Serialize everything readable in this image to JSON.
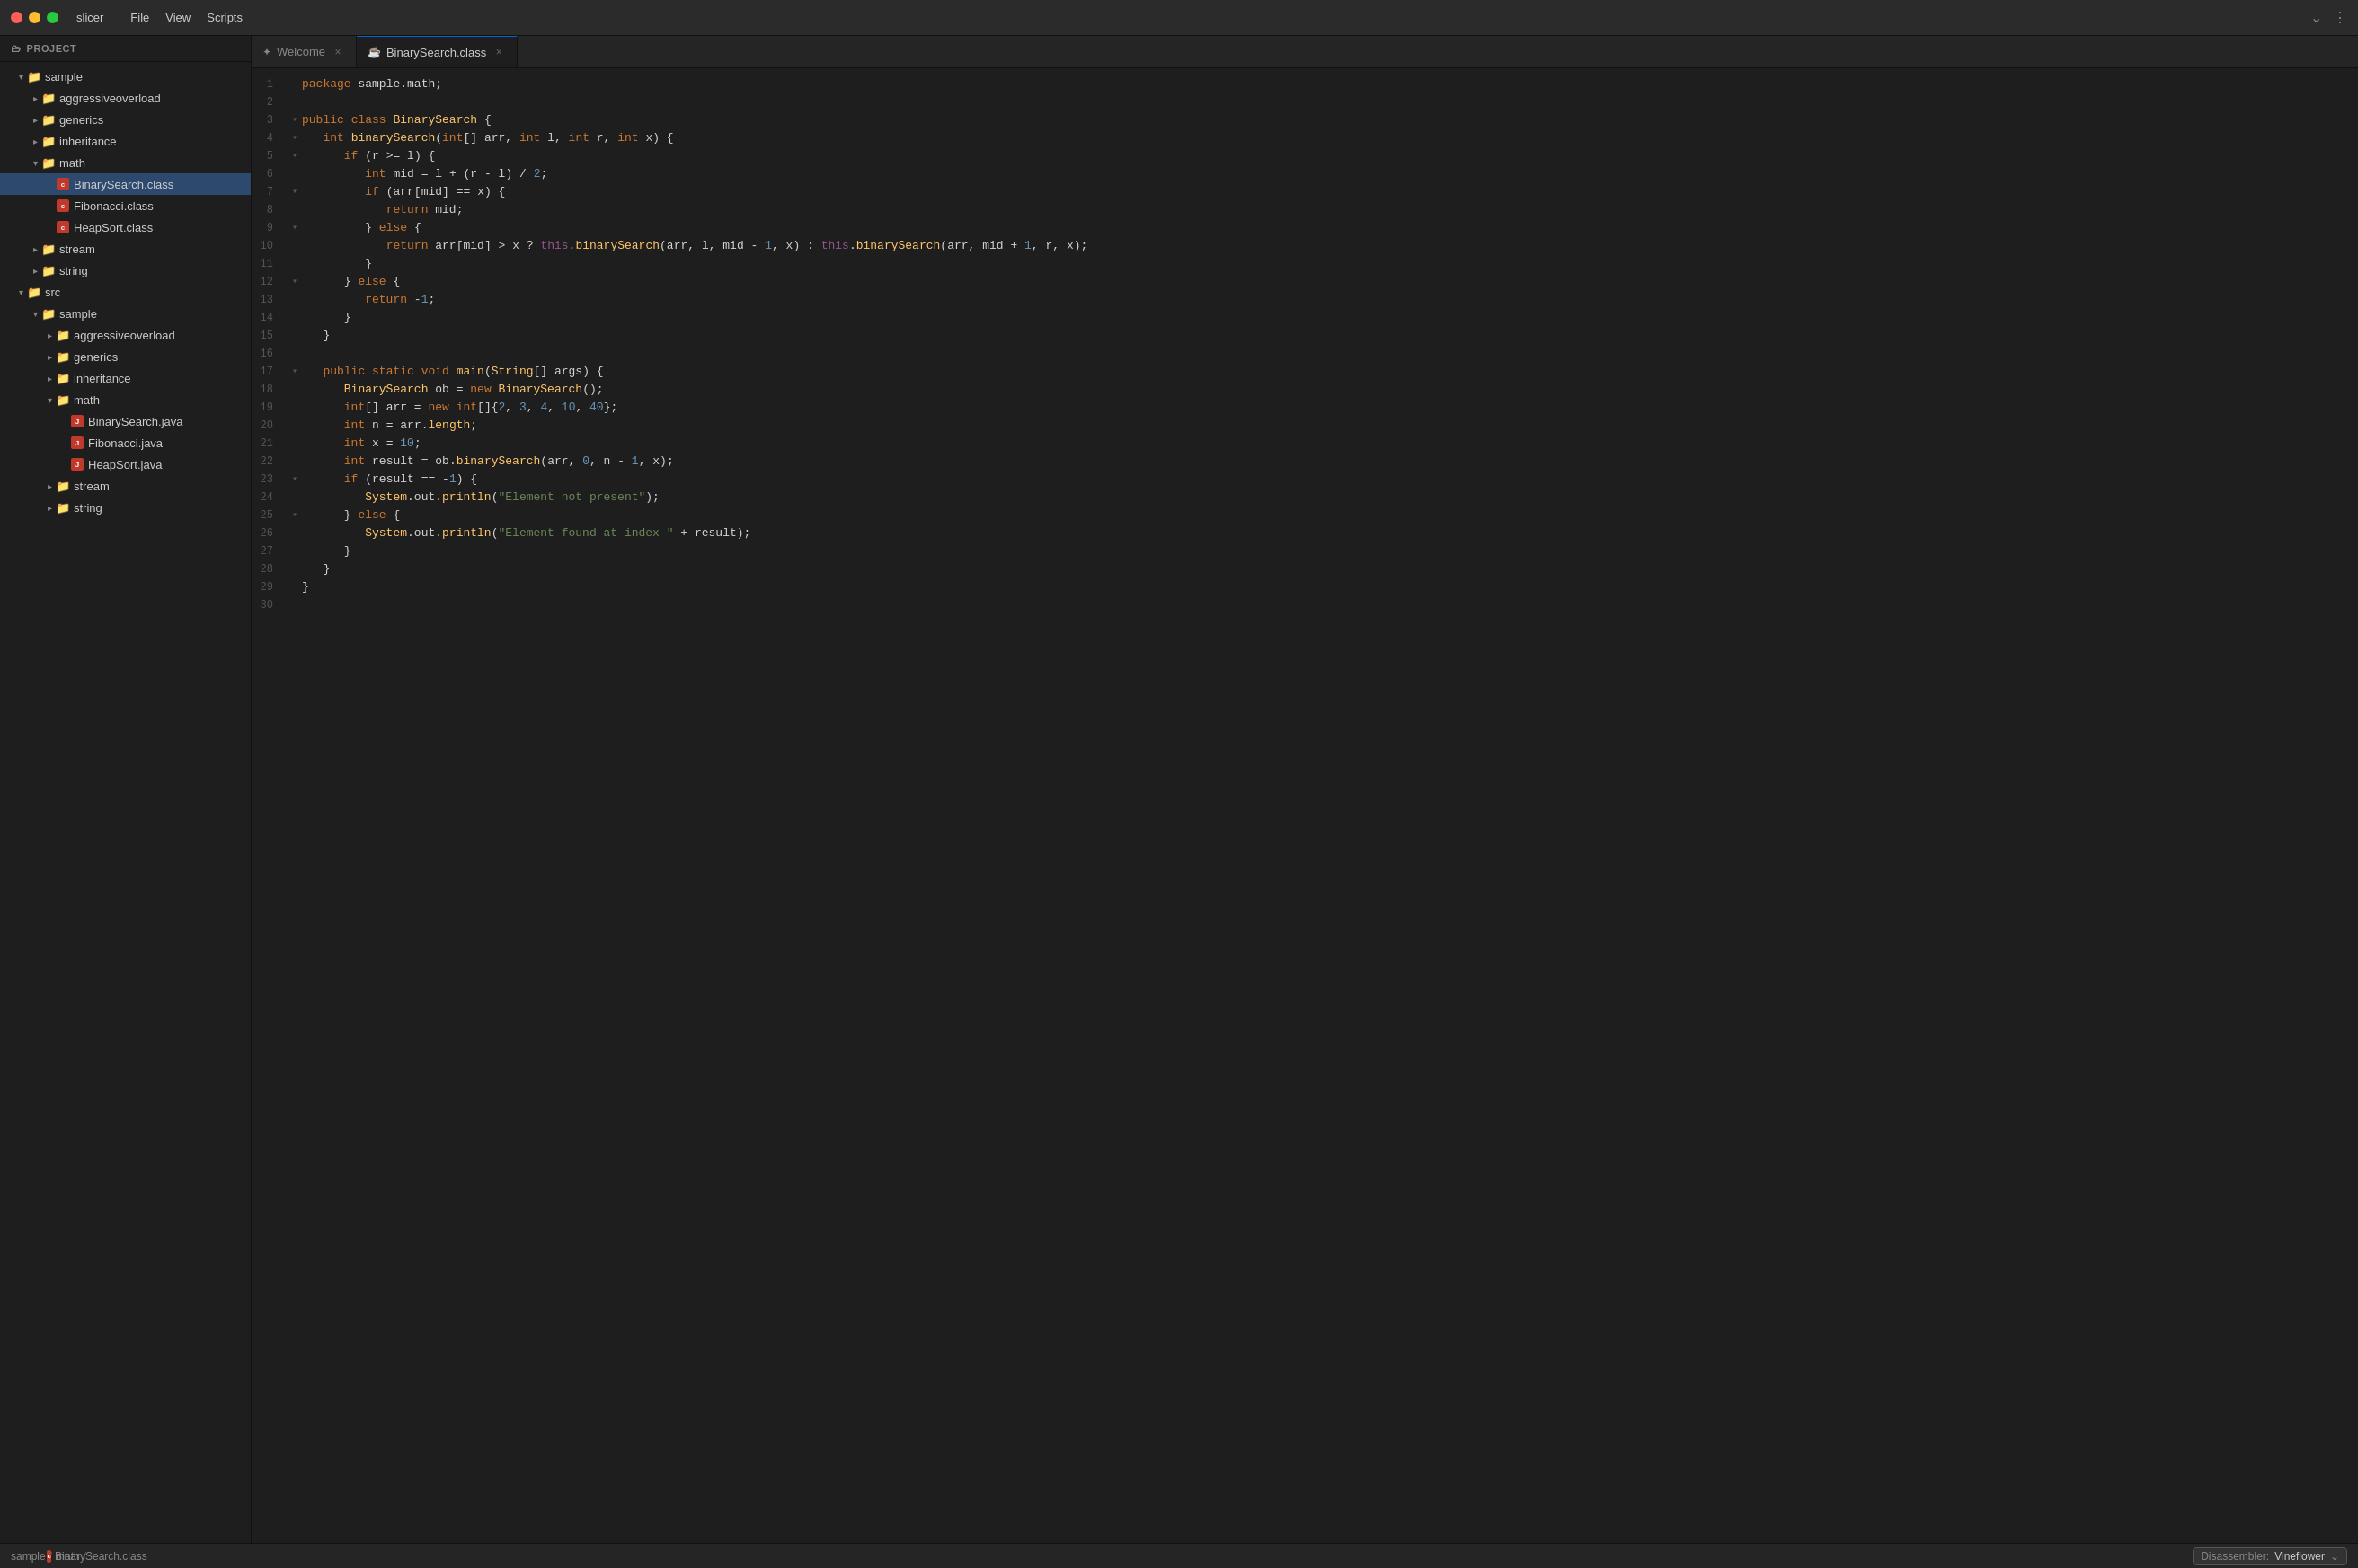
{
  "window": {
    "title": "slicer"
  },
  "menu": {
    "items": [
      "File",
      "View",
      "Scripts"
    ]
  },
  "tabs": [
    {
      "id": "welcome",
      "label": "Welcome",
      "icon": "✦",
      "active": false
    },
    {
      "id": "binarysearch-class",
      "label": "BinarySearch.class",
      "icon": "☕",
      "active": true
    }
  ],
  "sidebar": {
    "header": "Project",
    "tree": [
      {
        "id": "sample-root",
        "level": 0,
        "type": "folder",
        "expanded": true,
        "name": "sample"
      },
      {
        "id": "aggressiveoverload",
        "level": 1,
        "type": "folder",
        "expanded": false,
        "name": "aggressiveoverload"
      },
      {
        "id": "generics",
        "level": 1,
        "type": "folder",
        "expanded": false,
        "name": "generics"
      },
      {
        "id": "inheritance",
        "level": 1,
        "type": "folder",
        "expanded": false,
        "name": "inheritance"
      },
      {
        "id": "math",
        "level": 1,
        "type": "folder",
        "expanded": true,
        "name": "math"
      },
      {
        "id": "binarysearch-class",
        "level": 2,
        "type": "class",
        "active": true,
        "name": "BinarySearch.class"
      },
      {
        "id": "fibonacci-class",
        "level": 2,
        "type": "class",
        "name": "Fibonacci.class"
      },
      {
        "id": "heapsort-class",
        "level": 2,
        "type": "class",
        "name": "HeapSort.class"
      },
      {
        "id": "stream",
        "level": 1,
        "type": "folder",
        "expanded": false,
        "name": "stream"
      },
      {
        "id": "string",
        "level": 1,
        "type": "folder",
        "expanded": false,
        "name": "string"
      },
      {
        "id": "src",
        "level": 0,
        "type": "folder",
        "expanded": true,
        "name": "src"
      },
      {
        "id": "src-sample",
        "level": 1,
        "type": "folder",
        "expanded": true,
        "name": "sample"
      },
      {
        "id": "src-aggressiveoverload",
        "level": 2,
        "type": "folder",
        "expanded": false,
        "name": "aggressiveoverload"
      },
      {
        "id": "src-generics",
        "level": 2,
        "type": "folder",
        "expanded": false,
        "name": "generics"
      },
      {
        "id": "src-inheritance",
        "level": 2,
        "type": "folder",
        "expanded": false,
        "name": "inheritance"
      },
      {
        "id": "src-math",
        "level": 2,
        "type": "folder",
        "expanded": true,
        "name": "math"
      },
      {
        "id": "src-binarysearch-java",
        "level": 3,
        "type": "java",
        "name": "BinarySearch.java"
      },
      {
        "id": "src-fibonacci-java",
        "level": 3,
        "type": "java",
        "name": "Fibonacci.java"
      },
      {
        "id": "src-heapsort-java",
        "level": 3,
        "type": "java",
        "name": "HeapSort.java"
      },
      {
        "id": "src-stream",
        "level": 2,
        "type": "folder",
        "expanded": false,
        "name": "stream"
      },
      {
        "id": "src-string",
        "level": 2,
        "type": "folder",
        "expanded": false,
        "name": "string"
      }
    ]
  },
  "editor": {
    "filename": "BinarySearch.class",
    "lines": [
      {
        "num": 1,
        "fold": "",
        "content": "package sample.math;"
      },
      {
        "num": 2,
        "fold": "",
        "content": ""
      },
      {
        "num": 3,
        "fold": "v",
        "content": "public class BinarySearch {"
      },
      {
        "num": 4,
        "fold": "v",
        "content": "   int binarySearch(int[] arr, int l, int r, int x) {"
      },
      {
        "num": 5,
        "fold": "v",
        "content": "      if (r >= l) {"
      },
      {
        "num": 6,
        "fold": "",
        "content": "         int mid = l + (r - l) / 2;"
      },
      {
        "num": 7,
        "fold": "v",
        "content": "         if (arr[mid] == x) {"
      },
      {
        "num": 8,
        "fold": "",
        "content": "            return mid;"
      },
      {
        "num": 9,
        "fold": "v",
        "content": "         } else {"
      },
      {
        "num": 10,
        "fold": "",
        "content": "            return arr[mid] > x ? this.binarySearch(arr, l, mid - 1, x) : this.binarySearch(arr, mid + 1, r, x);"
      },
      {
        "num": 11,
        "fold": "",
        "content": "         }"
      },
      {
        "num": 12,
        "fold": "v",
        "content": "      } else {"
      },
      {
        "num": 13,
        "fold": "",
        "content": "         return -1;"
      },
      {
        "num": 14,
        "fold": "",
        "content": "      }"
      },
      {
        "num": 15,
        "fold": "",
        "content": "   }"
      },
      {
        "num": 16,
        "fold": "",
        "content": ""
      },
      {
        "num": 17,
        "fold": "v",
        "content": "   public static void main(String[] args) {"
      },
      {
        "num": 18,
        "fold": "",
        "content": "      BinarySearch ob = new BinarySearch();"
      },
      {
        "num": 19,
        "fold": "",
        "content": "      int[] arr = new int[]{2, 3, 4, 10, 40};"
      },
      {
        "num": 20,
        "fold": "",
        "content": "      int n = arr.length;"
      },
      {
        "num": 21,
        "fold": "",
        "content": "      int x = 10;"
      },
      {
        "num": 22,
        "fold": "",
        "content": "      int result = ob.binarySearch(arr, 0, n - 1, x);"
      },
      {
        "num": 23,
        "fold": "v",
        "content": "      if (result == -1) {"
      },
      {
        "num": 24,
        "fold": "",
        "content": "         System.out.println(\"Element not present\");"
      },
      {
        "num": 25,
        "fold": "v",
        "content": "      } else {"
      },
      {
        "num": 26,
        "fold": "",
        "content": "         System.out.println(\"Element found at index \" + result);"
      },
      {
        "num": 27,
        "fold": "",
        "content": "      }"
      },
      {
        "num": 28,
        "fold": "",
        "content": "   }"
      },
      {
        "num": 29,
        "fold": "",
        "content": "}"
      },
      {
        "num": 30,
        "fold": "",
        "content": ""
      }
    ]
  },
  "statusBar": {
    "breadcrumb": [
      "sample",
      "/",
      "math",
      "/",
      "BinarySearch.class"
    ],
    "disassembler_label": "Disassembler:",
    "disassembler_value": "Vineflower"
  }
}
